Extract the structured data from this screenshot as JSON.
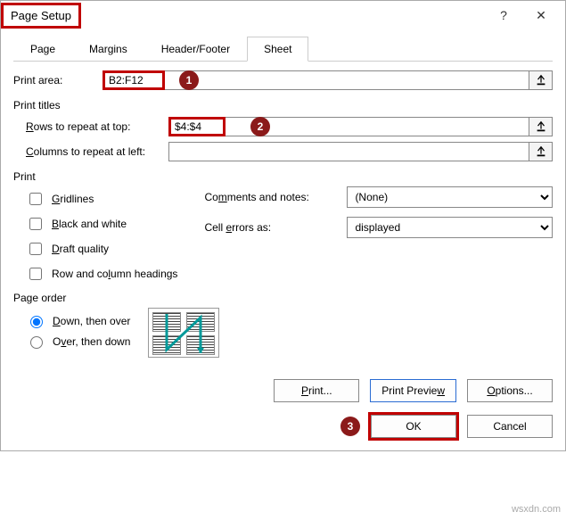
{
  "title": "Page Setup",
  "tabs": {
    "page": "Page",
    "margins": "Margins",
    "headerfooter": "Header/Footer",
    "sheet": "Sheet"
  },
  "print_area": {
    "label": "Print area:",
    "value": "B2:F12"
  },
  "print_titles": {
    "label": "Print titles",
    "rows_label": "Rows to repeat at top:",
    "rows_value": "$4:$4",
    "cols_label": "Columns to repeat at left:",
    "cols_value": ""
  },
  "print": {
    "label": "Print",
    "gridlines": "Gridlines",
    "bw": "Black and white",
    "draft": "Draft quality",
    "rowcol": "Row and column headings",
    "comments_label": "Comments and notes:",
    "comments_value": "(None)",
    "errors_label": "Cell errors as:",
    "errors_value": "displayed"
  },
  "page_order": {
    "label": "Page order",
    "down_over": "Down, then over",
    "over_down": "Over, then down"
  },
  "buttons": {
    "print": "Print...",
    "preview": "Print Preview",
    "options": "Options...",
    "ok": "OK",
    "cancel": "Cancel"
  },
  "callouts": {
    "c1": "1",
    "c2": "2",
    "c3": "3"
  },
  "watermark": "wsxdn.com"
}
